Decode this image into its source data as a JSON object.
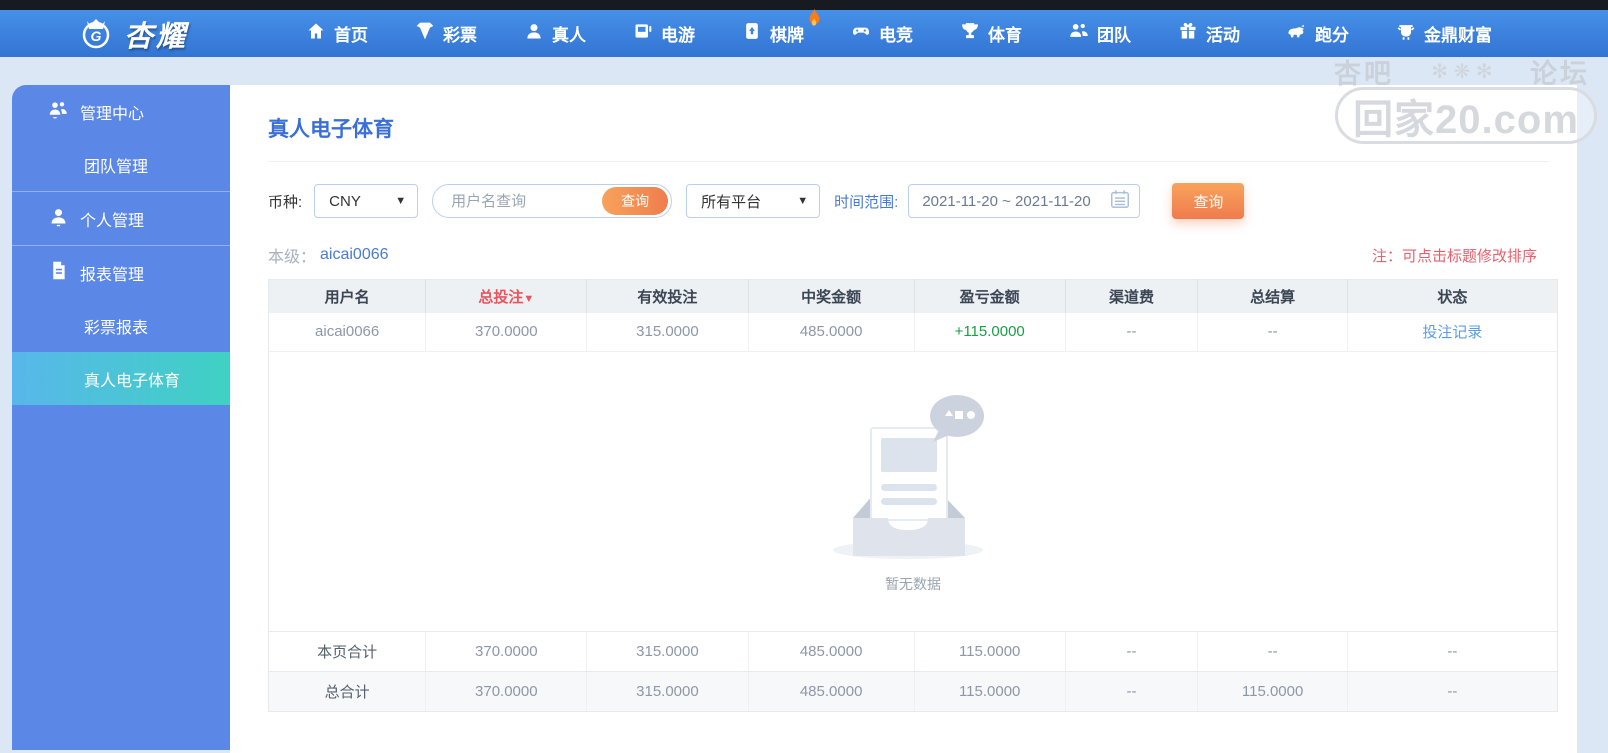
{
  "brand": {
    "name": "杏耀"
  },
  "navbar": {
    "items": [
      {
        "label": "首页",
        "icon": "home-icon"
      },
      {
        "label": "彩票",
        "icon": "lottery-icon"
      },
      {
        "label": "真人",
        "icon": "live-icon"
      },
      {
        "label": "电游",
        "icon": "slots-icon"
      },
      {
        "label": "棋牌",
        "icon": "cards-icon",
        "badge": "flame-icon"
      },
      {
        "label": "电竞",
        "icon": "esports-icon"
      },
      {
        "label": "体育",
        "icon": "sports-icon"
      },
      {
        "label": "团队",
        "icon": "team-icon"
      },
      {
        "label": "活动",
        "icon": "activity-icon"
      },
      {
        "label": "跑分",
        "icon": "paofen-icon"
      },
      {
        "label": "金鼎财富",
        "icon": "wealth-icon"
      }
    ]
  },
  "sidebar": {
    "items": [
      {
        "label": "管理中心",
        "icon": "group-icon",
        "type": "group"
      },
      {
        "label": "团队管理",
        "type": "sub"
      },
      {
        "label": "个人管理",
        "icon": "person-icon",
        "type": "group"
      },
      {
        "label": "报表管理",
        "icon": "report-icon",
        "type": "group"
      },
      {
        "label": "彩票报表",
        "type": "sub"
      },
      {
        "label": "真人电子体育",
        "type": "sub",
        "active": true
      }
    ]
  },
  "page": {
    "title": "真人电子体育",
    "level_label": "本级：",
    "level_value": "aicai0066",
    "sort_note": "注：可点击标题修改排序"
  },
  "filters": {
    "currency_label": "币种:",
    "currency_value": "CNY",
    "username_placeholder": "用户名查询",
    "inline_search_label": "查询",
    "platform_value": "所有平台",
    "date_label": "时间范围:",
    "date_value": "2021-11-20 ~ 2021-11-20",
    "search_label": "查询"
  },
  "table": {
    "headers": [
      "用户名",
      "总投注",
      "有效投注",
      "中奖金额",
      "盈亏金额",
      "渠道费",
      "总结算",
      "状态"
    ],
    "sort_indicator": "▼",
    "row": {
      "username": "aicai0066",
      "total_bet": "370.0000",
      "valid_bet": "315.0000",
      "win_amount": "485.0000",
      "profit": "+115.0000",
      "channel_fee": "--",
      "settlement": "--",
      "status_link": "投注记录"
    },
    "empty_text": "暂无数据",
    "page_total": {
      "label": "本页合计",
      "values": [
        "370.0000",
        "315.0000",
        "485.0000",
        "115.0000",
        "--",
        "--",
        "--"
      ]
    },
    "grand_total": {
      "label": "总合计",
      "values": [
        "370.0000",
        "315.0000",
        "485.0000",
        "115.0000",
        "--",
        "115.0000",
        "--"
      ]
    }
  },
  "watermark": {
    "top_left": "杏吧",
    "top_right": "论坛",
    "ornament": "✻",
    "main": "回家20.com"
  },
  "colors": {
    "accent_blue": "#3a6fd8",
    "navbar_blue": "#3d85e0",
    "sidebar_blue": "#5b87e6",
    "active_cyan_start": "#58b7ea",
    "active_cyan_end": "#3fd1c3",
    "orange_start": "#f8a25b",
    "orange_end": "#ef7d4e",
    "header_sort_red": "#e8555f",
    "note_red": "#e8606c",
    "profit_green": "#1a9e46",
    "link_blue": "#5c9ce6",
    "page_bg": "#dbe7f4"
  }
}
